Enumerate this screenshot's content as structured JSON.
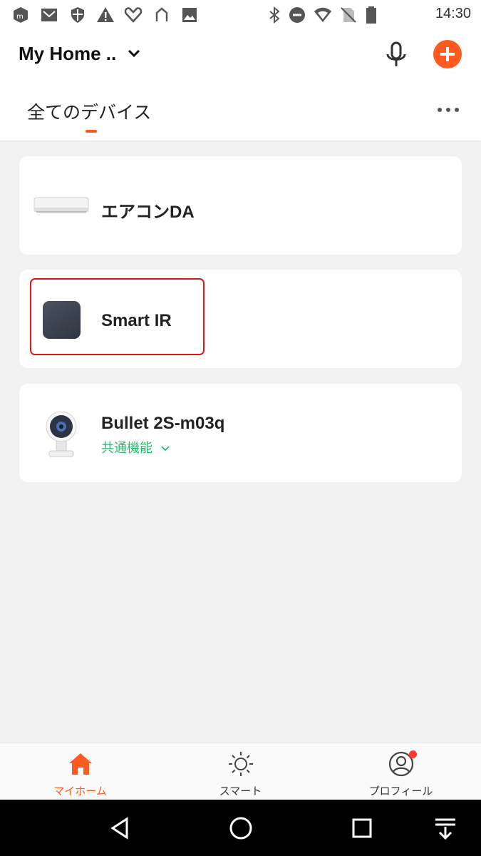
{
  "status_bar": {
    "time": "14:30",
    "icons": [
      "m-logo-icon",
      "mail-icon",
      "shield-icon",
      "warning-icon",
      "heart-link-icon",
      "arch-icon",
      "image-icon",
      "bluetooth-icon",
      "do-not-disturb-icon",
      "wifi-icon",
      "no-sim-icon",
      "battery-icon"
    ]
  },
  "header": {
    "home_name": "My Home ..",
    "tab_label": "全てのデバイス"
  },
  "devices": [
    {
      "name": "エアコンDA",
      "icon": "air-conditioner-image"
    },
    {
      "name": "Smart IR",
      "icon": "smart-ir-hub-image"
    },
    {
      "name": "Bullet 2S-m03q",
      "subtitle": "共通機能",
      "icon": "camera-image"
    }
  ],
  "bottom_nav": {
    "home": "マイホーム",
    "smart": "スマート",
    "profile": "プロフィール"
  },
  "colors": {
    "accent": "#ff5a1f",
    "green": "#1fbf6a",
    "highlight": "#e01818",
    "background": "#f2f2f3"
  }
}
